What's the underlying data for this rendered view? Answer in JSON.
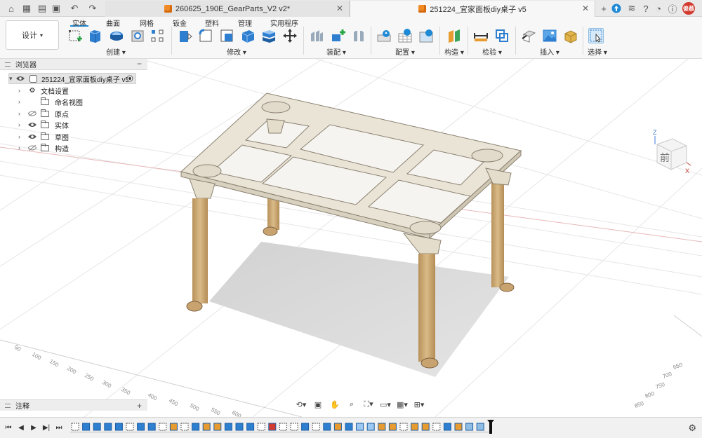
{
  "title_bar": {
    "tabs": [
      {
        "label": "260625_190E_GearParts_V2 v2*",
        "active": false
      },
      {
        "label": "251224_宜家面板diy桌子 v5",
        "active": true
      }
    ],
    "avatar_text": "俊蔡"
  },
  "toolbar": {
    "workspace": "设计",
    "tabs": [
      "实体",
      "曲面",
      "网格",
      "钣金",
      "塑料",
      "管理",
      "实用程序"
    ],
    "active_tab": "实体",
    "groups": [
      "创建",
      "修改",
      "装配",
      "配置",
      "构造",
      "检验",
      "插入",
      "选择"
    ]
  },
  "browser": {
    "title": "浏览器",
    "root": "251224_宜家面板diy桌子 v5",
    "items": [
      "文档设置",
      "命名视图",
      "原点",
      "实体",
      "草图",
      "构造"
    ]
  },
  "notes": {
    "title": "注释"
  },
  "viewcube": {
    "face": "前",
    "axis_z": "Z",
    "axis_x": "X"
  },
  "grid_labels": [
    "50",
    "100",
    "150",
    "200",
    "250",
    "300",
    "350",
    "400",
    "450",
    "500",
    "550",
    "600",
    "650",
    "700",
    "750",
    "800",
    "850"
  ],
  "colors": {
    "accent": "#1e8ad6",
    "leg": "#d2b27e",
    "frame": "#e9e2d4",
    "avatar": "#d23a2f"
  }
}
